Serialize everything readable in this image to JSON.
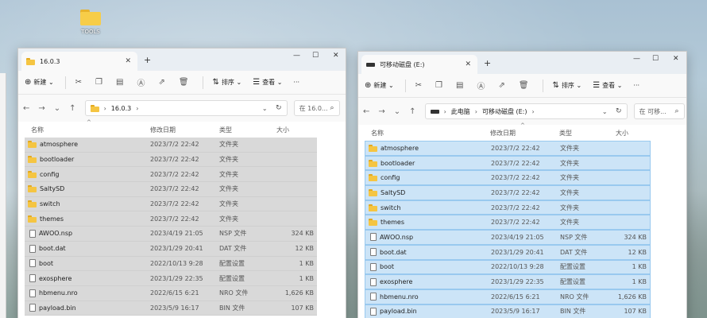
{
  "desktop": {
    "icon_label": "TOOLS"
  },
  "left": {
    "tab_title": "16.0.3",
    "toolbar": {
      "new_label": "新建",
      "sort_label": "排序",
      "view_label": "查看",
      "more": "···"
    },
    "address": {
      "segments": [
        "16.0.3"
      ],
      "search_placeholder": "在 16.0..."
    },
    "columns": {
      "name": "名称",
      "date": "修改日期",
      "type": "类型",
      "size": "大小"
    },
    "rows": [
      {
        "name": "atmosphere",
        "date": "2023/7/2 22:42",
        "type": "文件夹",
        "size": "",
        "kind": "folder"
      },
      {
        "name": "bootloader",
        "date": "2023/7/2 22:42",
        "type": "文件夹",
        "size": "",
        "kind": "folder"
      },
      {
        "name": "config",
        "date": "2023/7/2 22:42",
        "type": "文件夹",
        "size": "",
        "kind": "folder"
      },
      {
        "name": "SaltySD",
        "date": "2023/7/2 22:42",
        "type": "文件夹",
        "size": "",
        "kind": "folder"
      },
      {
        "name": "switch",
        "date": "2023/7/2 22:42",
        "type": "文件夹",
        "size": "",
        "kind": "folder"
      },
      {
        "name": "themes",
        "date": "2023/7/2 22:42",
        "type": "文件夹",
        "size": "",
        "kind": "folder"
      },
      {
        "name": "AWOO.nsp",
        "date": "2023/4/19 21:05",
        "type": "NSP 文件",
        "size": "324 KB",
        "kind": "file"
      },
      {
        "name": "boot.dat",
        "date": "2023/1/29 20:41",
        "type": "DAT 文件",
        "size": "12 KB",
        "kind": "file"
      },
      {
        "name": "boot",
        "date": "2022/10/13 9:28",
        "type": "配置设置",
        "size": "1 KB",
        "kind": "file"
      },
      {
        "name": "exosphere",
        "date": "2023/1/29 22:35",
        "type": "配置设置",
        "size": "1 KB",
        "kind": "file"
      },
      {
        "name": "hbmenu.nro",
        "date": "2022/6/15 6:21",
        "type": "NRO 文件",
        "size": "1,626 KB",
        "kind": "file"
      },
      {
        "name": "payload.bin",
        "date": "2023/5/9 16:17",
        "type": "BIN 文件",
        "size": "107 KB",
        "kind": "file"
      }
    ]
  },
  "right": {
    "tab_title": "可移动磁盘 (E:)",
    "toolbar": {
      "new_label": "新建",
      "sort_label": "排序",
      "view_label": "查看",
      "more": "···"
    },
    "address": {
      "segments": [
        "此电脑",
        "可移动磁盘 (E:)"
      ],
      "search_placeholder": "在 可移..."
    },
    "columns": {
      "name": "名称",
      "date": "修改日期",
      "type": "类型",
      "size": "大小"
    },
    "rows": [
      {
        "name": "atmosphere",
        "date": "2023/7/2 22:42",
        "type": "文件夹",
        "size": "",
        "kind": "folder"
      },
      {
        "name": "bootloader",
        "date": "2023/7/2 22:42",
        "type": "文件夹",
        "size": "",
        "kind": "folder"
      },
      {
        "name": "config",
        "date": "2023/7/2 22:42",
        "type": "文件夹",
        "size": "",
        "kind": "folder"
      },
      {
        "name": "SaltySD",
        "date": "2023/7/2 22:42",
        "type": "文件夹",
        "size": "",
        "kind": "folder"
      },
      {
        "name": "switch",
        "date": "2023/7/2 22:42",
        "type": "文件夹",
        "size": "",
        "kind": "folder"
      },
      {
        "name": "themes",
        "date": "2023/7/2 22:42",
        "type": "文件夹",
        "size": "",
        "kind": "folder"
      },
      {
        "name": "AWOO.nsp",
        "date": "2023/4/19 21:05",
        "type": "NSP 文件",
        "size": "324 KB",
        "kind": "file"
      },
      {
        "name": "boot.dat",
        "date": "2023/1/29 20:41",
        "type": "DAT 文件",
        "size": "12 KB",
        "kind": "file"
      },
      {
        "name": "boot",
        "date": "2022/10/13 9:28",
        "type": "配置设置",
        "size": "1 KB",
        "kind": "file"
      },
      {
        "name": "exosphere",
        "date": "2023/1/29 22:35",
        "type": "配置设置",
        "size": "1 KB",
        "kind": "file"
      },
      {
        "name": "hbmenu.nro",
        "date": "2022/6/15 6:21",
        "type": "NRO 文件",
        "size": "1,626 KB",
        "kind": "file"
      },
      {
        "name": "payload.bin",
        "date": "2023/5/9 16:17",
        "type": "BIN 文件",
        "size": "107 KB",
        "kind": "file"
      }
    ]
  }
}
